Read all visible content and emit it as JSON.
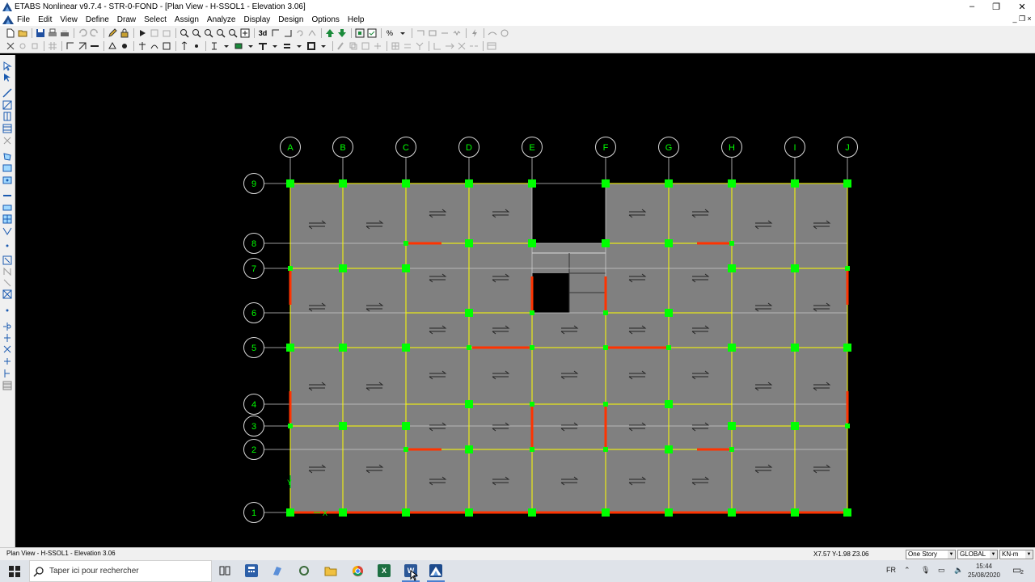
{
  "window": {
    "title": "ETABS Nonlinear v9.7.4 - STR-0-FOND - [Plan View - H-SSOL1 - Elevation 3.06]",
    "minimize": "–",
    "restore": "❐",
    "close": "✕"
  },
  "menu": {
    "items": [
      "File",
      "Edit",
      "View",
      "Define",
      "Draw",
      "Select",
      "Assign",
      "Analyze",
      "Display",
      "Design",
      "Options",
      "Help"
    ],
    "mdi_min": "_",
    "mdi_restore": "❐",
    "mdi_close": "×"
  },
  "toolbar_labels": {
    "view3d": "3d",
    "percent": "%"
  },
  "plan": {
    "columns": [
      "A",
      "B",
      "C",
      "D",
      "E",
      "F",
      "G",
      "H",
      "I",
      "J"
    ],
    "rows": [
      "9",
      "8",
      "7",
      "6",
      "5",
      "4",
      "3",
      "2",
      "1"
    ],
    "axis_x": "X",
    "axis_y": "Y",
    "colors": {
      "slab": "#808080",
      "grid": "#cccccc",
      "beam": "#ffff00",
      "bubble": "#00ff00",
      "support": "#00ff00",
      "wall": "#ff3300",
      "void": "#000000"
    }
  },
  "status": {
    "text": "Plan View - H-SSOL1 - Elevation 3.06",
    "coords": "X7.57  Y-1.98  Z3.06",
    "story": "One Story",
    "coord_system": "GLOBAL",
    "units": "KN-m"
  },
  "taskbar": {
    "search_placeholder": "Taper ici pour rechercher",
    "lang": "FR",
    "time": "15:44",
    "date": "25/08/2020",
    "notif_count": "2"
  }
}
